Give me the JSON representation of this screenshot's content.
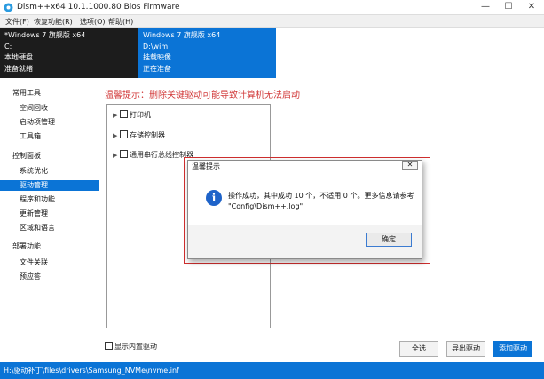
{
  "window": {
    "title": "Dism++x64 10.1.1000.80 Bios Firmware",
    "minimize": "—",
    "maximize": "☐",
    "close": "✕"
  },
  "menu": [
    "文件(F)",
    "恢复功能(R)",
    "选项(O)",
    "帮助(H)"
  ],
  "sessions": [
    {
      "name": "*Windows 7 旗舰版 x64",
      "path": "C:",
      "type": "本地硬盘",
      "status": "准备就绪"
    },
    {
      "name": "Windows 7 旗舰版 x64",
      "path": "D:\\wim",
      "type": "挂载映像",
      "status": "正在准备"
    }
  ],
  "sidebar": {
    "groups": [
      {
        "title": "常用工具",
        "items": [
          "空间回收",
          "启动项管理",
          "工具箱"
        ]
      },
      {
        "title": "控制面板",
        "items": [
          "系统优化",
          "驱动管理",
          "程序和功能",
          "更新管理",
          "区域和语言"
        ]
      },
      {
        "title": "部署功能",
        "items": [
          "文件关联",
          "预应答"
        ]
      }
    ],
    "selected": "驱动管理"
  },
  "main": {
    "warning": "温馨提示：删除关键驱动可能导致计算机无法启动",
    "tree": [
      "打印机",
      "存储控制器",
      "通用串行总线控制器"
    ],
    "show_builtin": "显示内置驱动",
    "buttons": {
      "select_all": "全选",
      "export": "导出驱动",
      "add": "添加驱动"
    }
  },
  "statusbar": "H:\\驱动补丁\\files\\drivers\\Samsung_NVMe\\nvme.inf",
  "dialog": {
    "title": "温馨提示",
    "close": "✕",
    "line1": "操作成功，其中成功 10 个，不适用 0 个。更多信息请参考",
    "line2": "\"Config\\Dism++.log\"",
    "ok": "确定",
    "icon": "i"
  },
  "colors": {
    "accent": "#0b74d6",
    "session_dark": "#1c1c1c",
    "warning": "#d23a3a",
    "dialog_outline": "#cf2e2e"
  }
}
